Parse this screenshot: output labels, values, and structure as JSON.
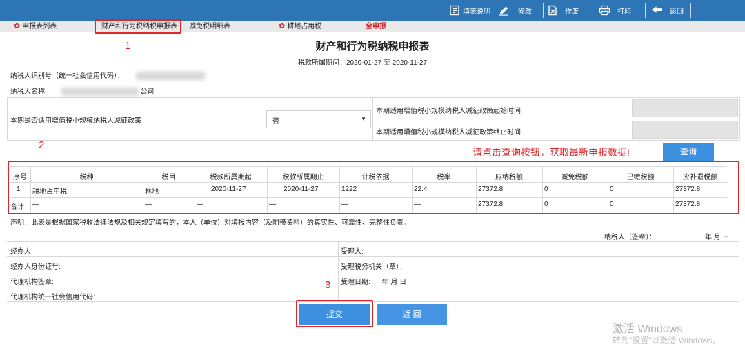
{
  "toolbar": {
    "fill_help": "填表说明",
    "edit": "修改",
    "void": "作废",
    "print": "打印",
    "back": "返回"
  },
  "tabs": [
    {
      "label": "申报表列表"
    },
    {
      "label": "财产和行为税纳税申报表"
    },
    {
      "label": "减免税明细表"
    },
    {
      "label": "耕地占用税"
    },
    {
      "label": "全申报"
    }
  ],
  "annotations": {
    "n1": "1",
    "n2": "2",
    "n3": "3"
  },
  "form": {
    "title": "财产和行为税纳税申报表",
    "period_label": "税款所属期间：",
    "period_value": "2020-01-27 至 2020-11-27",
    "taxpayer_id_label": "纳税人识别号（统一社会信用代码）：",
    "taxpayer_name_label": "纳税人名称:",
    "taxpayer_name_suffix": "公司",
    "policy_question": "本期是否适用增值税小规模纳税人减征政策",
    "policy_value": "否",
    "policy_start_label": "本期适用增值税小规模纳税人减征政策起始时间",
    "policy_end_label": "本期适用增值税小规模纳税人减征政策终止时间",
    "notice": "请点击查询按钮，获取最新申报数据!",
    "query_button": "查询"
  },
  "table": {
    "headers": [
      "序号",
      "税种",
      "税目",
      "税款所属期起",
      "税款所属期止",
      "计税依据",
      "税率",
      "应纳税额",
      "减免税额",
      "已缴税额",
      "应补退税额"
    ],
    "rows": [
      [
        "1",
        "耕地占用税",
        "林地",
        "2020-11-27",
        "2020-11-27",
        "1222",
        "22.4",
        "27372.8",
        "0",
        "0",
        "27372.8"
      ],
      [
        "合计",
        "—",
        "—",
        "—",
        "—",
        "—",
        "—",
        "27372.8",
        "0",
        "0",
        "27372.8"
      ]
    ]
  },
  "declaration": "声明：此表是根据国家税收法律法规及相关规定填写的，本人（单位）对填报内容（及附带资料）的真实性、可靠性、完整性负责。",
  "signature": {
    "taxpayer_sign": "纳税人（签章）：",
    "date": "年 月 日",
    "handler": "经办人:",
    "handler_id": "经办人身份证号:",
    "agency_seal": "代理机构签章:",
    "agency_code": "代理机构统一社会信用代码:",
    "receiver": "受理人:",
    "tax_authority": "受理税务机关（章）：",
    "receive_date_label": "受理日期:",
    "receive_date_value": "年 月 日"
  },
  "buttons": {
    "submit": "提交",
    "back": "返 回"
  },
  "watermark": {
    "line1": "激活 Windows",
    "line2": "转到\"设置\"以激活 Windows。"
  },
  "colors": {
    "toolbar": "#2e75b6",
    "button": "#3d8fe0",
    "annotation": "#e0242a"
  }
}
